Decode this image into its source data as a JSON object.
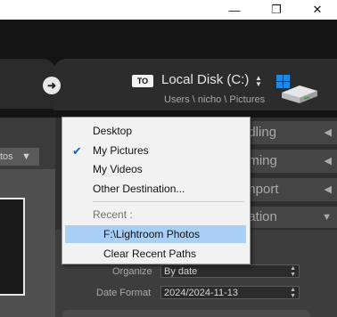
{
  "window_controls": {
    "minimize": "—",
    "maximize": "❐",
    "close": "✕"
  },
  "destination": {
    "to_badge": "TO",
    "disk_label": "Local Disk (C:)",
    "path": "Users \\ nicho \\ Pictures"
  },
  "left_panel": {
    "tab_label": "tos"
  },
  "right_sections": {
    "handling": "ndling",
    "renaming": "aming",
    "import": "Import",
    "destination": "nation"
  },
  "form": {
    "organize_label": "Organize",
    "organize_value": "By date",
    "date_format_label": "Date Format",
    "date_format_value": "2024/2024-11-13"
  },
  "menu": {
    "items": [
      "Desktop",
      "My Pictures",
      "My Videos",
      "Other Destination..."
    ],
    "checked_item": "My Pictures",
    "recent_label": "Recent :",
    "recent_paths": [
      "F:\\Lightroom Photos"
    ],
    "clear_label": "Clear Recent Paths"
  },
  "colors": {
    "highlight": "#a8cff5",
    "check": "#1f5fbf"
  }
}
